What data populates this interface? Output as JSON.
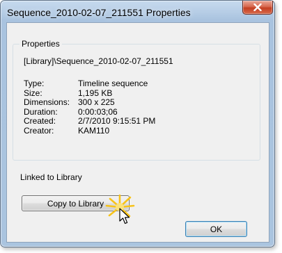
{
  "window": {
    "title": "Sequence_2010-02-07_211551 Properties"
  },
  "properties_group": {
    "label": "Properties",
    "path": "[Library]\\Sequence_2010-02-07_211551",
    "rows": [
      {
        "key": "Type:",
        "value": "Timeline sequence"
      },
      {
        "key": "Size:",
        "value": "1,195 KB"
      },
      {
        "key": "Dimensions:",
        "value": "300 x 225"
      },
      {
        "key": "Duration:",
        "value": "0:00:03;06"
      },
      {
        "key": "Created:",
        "value": "2/7/2010 9:15:51 PM"
      },
      {
        "key": "Creator:",
        "value": "KAM110"
      }
    ]
  },
  "linked_label": "Linked to Library",
  "buttons": {
    "copy_label": "Copy to Library",
    "ok_label": "OK"
  },
  "colors": {
    "title_bar": "#b9cfe7",
    "close_button": "#c33f22",
    "dialog_background": "#f0f0f0",
    "highlight": "#f7c31a"
  }
}
